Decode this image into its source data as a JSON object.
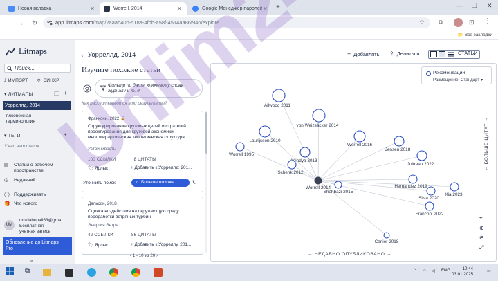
{
  "browser": {
    "tabs": [
      {
        "label": "Новая вкладка",
        "active": false,
        "fav_color": "#4a8cf7"
      },
      {
        "label": "Worrell, 2014",
        "active": true,
        "fav_color": "#2a3346"
      },
      {
        "label": "Google Менеджер паролей",
        "active": false,
        "fav_color": "#3b82f6"
      }
    ],
    "url_host": "app.litmaps.com",
    "url_path": "/map/2aaab40b-518a-4fbb-a58f-4514aa86f946/explore",
    "bookmarks_label": "Все закладки"
  },
  "sidebar": {
    "logo": "Litmaps",
    "search_placeholder": "Поиск...",
    "import_label": "ИМПОРТ",
    "sync_label": "СИНХР",
    "maps_section": "ЛИТМАПЫ",
    "active_map": "Уорреллд, 2014",
    "map_item_1": "тижовежная",
    "map_item_2": "терминология",
    "tags_section": "ТЕГИ",
    "no_tags": "У вас нет тегов",
    "article_link_1": "Статьи о рабочем",
    "article_link_2": "пространстве",
    "recent_link": "Недавний",
    "support_link": "Поддерживать",
    "whatsnew_link": "Что нового",
    "user_initials": "UM",
    "user_email": "umidahopali63@gma",
    "user_plan_1": "Бесплатная",
    "user_plan_2": "учетная запись",
    "upgrade_1": "Обновление до Litmaps",
    "upgrade_2": "Pro",
    "collapse": "«"
  },
  "header": {
    "breadcrumb": "Уорреллд, 2014",
    "add_label": "Добавлять",
    "share_label": "Делиться",
    "articles_label": "СТАТЬИ"
  },
  "panel": {
    "title": "Изучите похожие статьи",
    "filter_placeholder": "Фильтр по дате, ключевому слову, журналу и т. д.",
    "how_link": "Как рассчитываются эти результаты?",
    "cards": [
      {
        "meta": "Франкони, 2022",
        "title": "Структурирование крутовых целей и стратегий проектирования для крутовой экономики: многоиерархическая теоретическая структура",
        "topic": "Устойчивость",
        "refs": "100 ССЫЛКИ",
        "cites": "8 ЦИТАТЫ",
        "label": "Ярлык",
        "add": "Добавить к Уорреллд: 201..."
      },
      {
        "meta": "Дальсон, 2018",
        "title": "Оценка воздействия на окружающую среду переработки ветряных турбин",
        "topic": "Энергия Ветра",
        "refs": "42 ССЫЛКИ",
        "cites": "86 ЦИТАТЫ",
        "label": "Ярлык",
        "add": "Добавить к Уорреллу, 201..."
      }
    ],
    "search_label": "Уточнить поиск:",
    "more_button": "Больше похоже",
    "pager": "1 - 10 из 20"
  },
  "graph": {
    "legend_title": "Рекомендации",
    "legend_size": "Размещение: Стандарт",
    "x_axis": "НЕДАВНО ОПУБЛИКОВАНО",
    "y_axis": "БОЛЬШЕ ЦИТАТ",
    "nodes": [
      {
        "label": "Allwood 2011"
      },
      {
        "label": "von Weizsäcker 2014"
      },
      {
        "label": "Laurijssen 2010"
      },
      {
        "label": "Worrell 2016"
      },
      {
        "label": "Jensen 2018"
      },
      {
        "label": "Worrell 1995"
      },
      {
        "label": "Anindya 2013"
      },
      {
        "label": "Schenk 2012"
      },
      {
        "label": "Joltreau 2022"
      },
      {
        "label": "Worrell 2014"
      },
      {
        "label": "Hernandez 2019"
      },
      {
        "label": "Xia 2023"
      },
      {
        "label": "Silva 2020"
      },
      {
        "label": "Shahbazi 2015"
      },
      {
        "label": "Franconi 2022"
      },
      {
        "label": "Carlier 2018"
      }
    ]
  },
  "watermark": "Unlim24",
  "taskbar": {
    "lang": "ENG",
    "time": "10:44",
    "date": "03.01.2025"
  }
}
